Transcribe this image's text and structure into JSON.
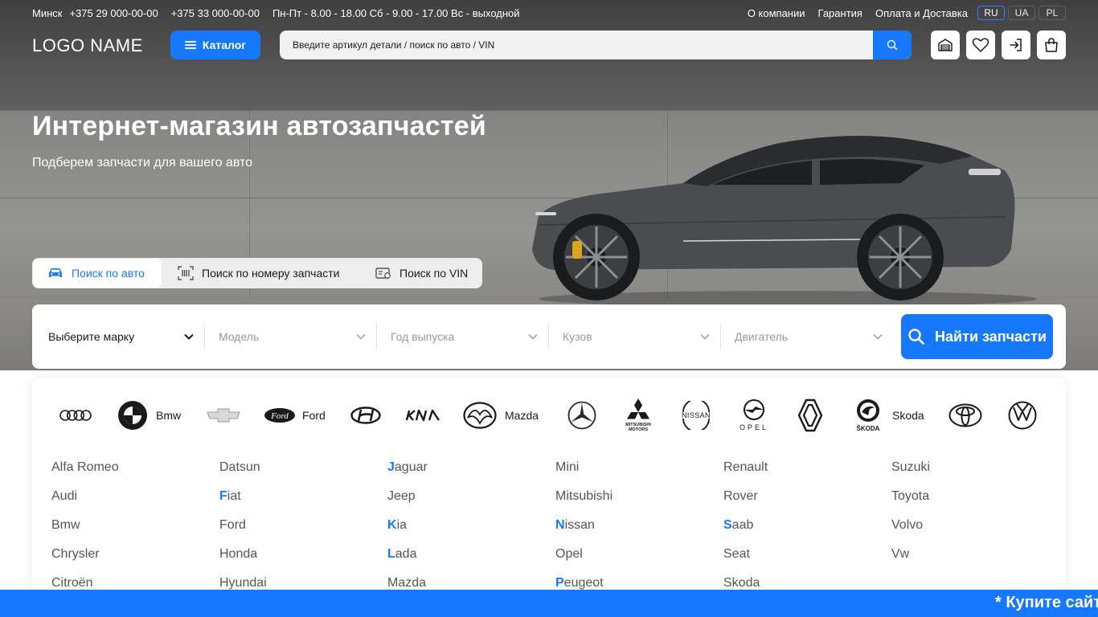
{
  "topbar": {
    "city": "Минск",
    "phones": [
      "+375 29 000-00-00",
      "+375 33 000-00-00"
    ],
    "hours": "Пн-Пт - 8.00 - 18.00 Сб - 9.00 - 17.00 Вс - выходной",
    "links": [
      "О компании",
      "Гарантия",
      "Оплата и Доставка"
    ],
    "languages": [
      "RU",
      "UA",
      "PL"
    ],
    "active_language": "RU"
  },
  "header": {
    "logo": "LOGO NAME",
    "catalog_label": "Каталог",
    "search_placeholder": "Введите артикул детали / поиск по авто / VIN",
    "icons": [
      "garage-icon",
      "heart-icon",
      "login-icon",
      "cart-icon"
    ]
  },
  "hero": {
    "title": "Интернет-магазин автозапчастей",
    "subtitle": "Подберем запчасти для вашего авто"
  },
  "search_tabs": [
    {
      "label": "Поиск по авто",
      "icon": "car-icon",
      "active": true
    },
    {
      "label": "Поиск по номеру запчасти",
      "icon": "barcode-icon",
      "active": false
    },
    {
      "label": "Поиск по VIN",
      "icon": "vin-card-icon",
      "active": false
    }
  ],
  "filters": {
    "brand": "Выберите марку",
    "model": "Модель",
    "year": "Год выпуска",
    "body": "Кузов",
    "engine": "Двигатель",
    "submit": "Найти запчасти"
  },
  "brand_logos": [
    {
      "icon": "audi-logo",
      "name": ""
    },
    {
      "icon": "bmw-logo",
      "name": "Bmw"
    },
    {
      "icon": "chevrolet-logo",
      "name": ""
    },
    {
      "icon": "ford-logo",
      "name": "Ford"
    },
    {
      "icon": "hyundai-logo",
      "name": ""
    },
    {
      "icon": "kia-logo",
      "name": ""
    },
    {
      "icon": "mazda-logo",
      "name": "Mazda"
    },
    {
      "icon": "mercedes-logo",
      "name": ""
    },
    {
      "icon": "mitsubishi-logo",
      "name": ""
    },
    {
      "icon": "nissan-logo",
      "name": ""
    },
    {
      "icon": "opel-logo",
      "name": ""
    },
    {
      "icon": "renault-logo",
      "name": ""
    },
    {
      "icon": "skoda-logo",
      "name": "Skoda"
    },
    {
      "icon": "toyota-logo",
      "name": ""
    },
    {
      "icon": "volkswagen-logo",
      "name": ""
    }
  ],
  "logo_lettering": {
    "ford": "Ford",
    "mitsubishi": "MITSUBISHI MOTORS",
    "nissan": "NISSAN",
    "opel": "OPEL",
    "skoda": "ŠKODA"
  },
  "brand_columns": [
    [
      {
        "first": "",
        "rest": "Alfa Romeo"
      },
      {
        "first": "",
        "rest": "Audi"
      },
      {
        "first": "",
        "rest": "Bmw"
      },
      {
        "first": "",
        "rest": "Chrysler"
      },
      {
        "first": "",
        "rest": "Citroën"
      }
    ],
    [
      {
        "first": "",
        "rest": "Datsun"
      },
      {
        "first": "F",
        "rest": "iat"
      },
      {
        "first": "",
        "rest": "Ford"
      },
      {
        "first": "",
        "rest": "Honda"
      },
      {
        "first": "",
        "rest": "Hyundai"
      }
    ],
    [
      {
        "first": "J",
        "rest": "aguar"
      },
      {
        "first": "",
        "rest": "Jeep"
      },
      {
        "first": "K",
        "rest": "ia"
      },
      {
        "first": "L",
        "rest": "ada"
      },
      {
        "first": "",
        "rest": "Mazda"
      }
    ],
    [
      {
        "first": "",
        "rest": "Mini"
      },
      {
        "first": "",
        "rest": "Mitsubishi"
      },
      {
        "first": "N",
        "rest": "issan"
      },
      {
        "first": "",
        "rest": "Opel"
      },
      {
        "first": "P",
        "rest": "eugeot"
      }
    ],
    [
      {
        "first": "",
        "rest": "Renault"
      },
      {
        "first": "",
        "rest": "Rover"
      },
      {
        "first": "S",
        "rest": "aab"
      },
      {
        "first": "",
        "rest": "Seat"
      },
      {
        "first": "",
        "rest": "Skoda"
      }
    ],
    [
      {
        "first": "",
        "rest": "Suzuki"
      },
      {
        "first": "",
        "rest": "Toyota"
      },
      {
        "first": "",
        "rest": "Volvo"
      },
      {
        "first": "",
        "rest": "Vw"
      }
    ]
  ],
  "marquee": "* Купите сайт",
  "colors": {
    "accent": "#1677ff",
    "text": "#1a1a1a",
    "muted": "#9a9a9a"
  }
}
